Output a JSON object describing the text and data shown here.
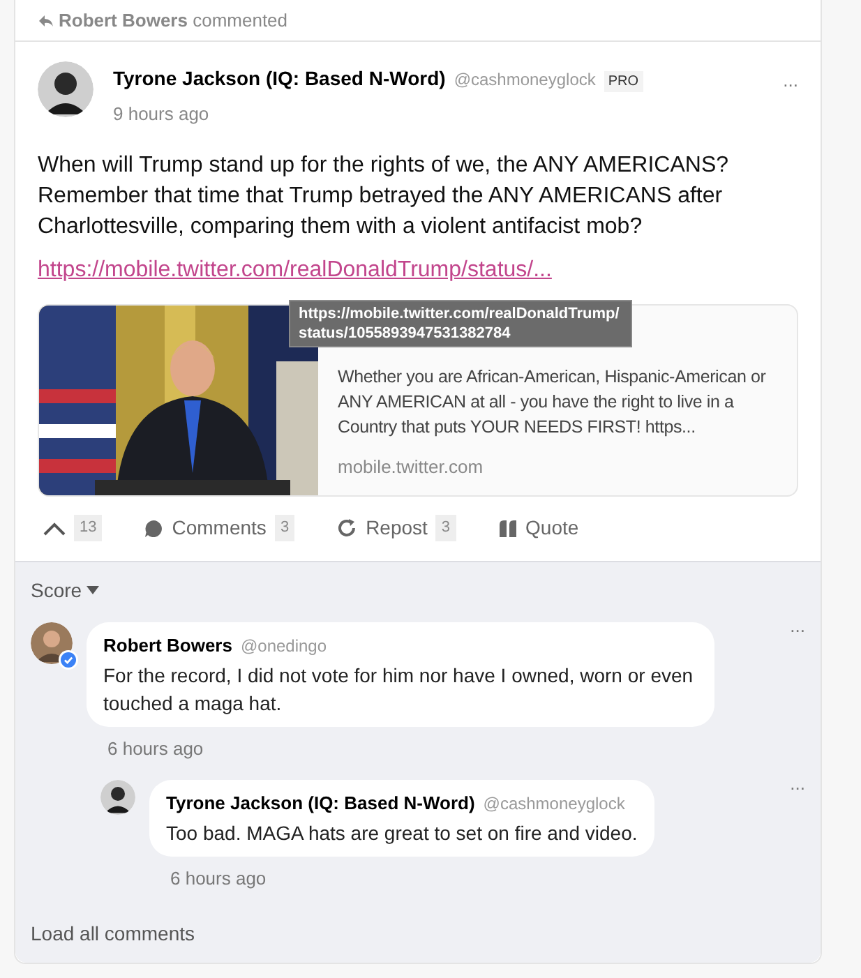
{
  "context": {
    "actor": "Robert Bowers",
    "action": "commented"
  },
  "post": {
    "author": "Tyrone Jackson (IQ: Based N-Word)",
    "handle": "@cashmoneyglock",
    "badge": "PRO",
    "time": "9 hours ago",
    "menu": "...",
    "body": "When will Trump stand up for the rights of we, the ANY AMERICANS? Remember that time that Trump betrayed the ANY AMERICANS after Charlottesville, comparing them with a violent antifacist mob?",
    "link": "https://mobile.twitter.com/realDonaldTrump/status/...",
    "preview": {
      "description": "Whether you are African-American, Hispanic-American or ANY AMERICAN at all - you have the right to live in a Country that puts YOUR NEEDS FIRST! https...",
      "domain": "mobile.twitter.com"
    },
    "tooltip": "https://mobile.twitter.com/realDonaldTrump/ status/1055893947531382784",
    "actions": [
      {
        "kind": "upvote",
        "count": "13"
      },
      {
        "kind": "comments",
        "label": "Comments",
        "count": "3"
      },
      {
        "kind": "repost",
        "label": "Repost",
        "count": "3"
      },
      {
        "kind": "quote",
        "label": "Quote"
      }
    ]
  },
  "comments": {
    "sort": "Score",
    "items": [
      {
        "author": "Robert Bowers",
        "handle": "@onedingo",
        "verified": true,
        "text": "For the record, I did not vote for him nor have I owned, worn or even touched a maga hat.",
        "time": "6 hours ago",
        "menu": "...",
        "children": [
          {
            "author": "Tyrone Jackson (IQ: Based N-Word)",
            "handle": "@cashmoneyglock",
            "verified": false,
            "text": "Too bad. MAGA hats are great to set on fire and video.",
            "time": "6 hours ago",
            "menu": "..."
          }
        ]
      }
    ],
    "load_all": "Load all comments"
  }
}
